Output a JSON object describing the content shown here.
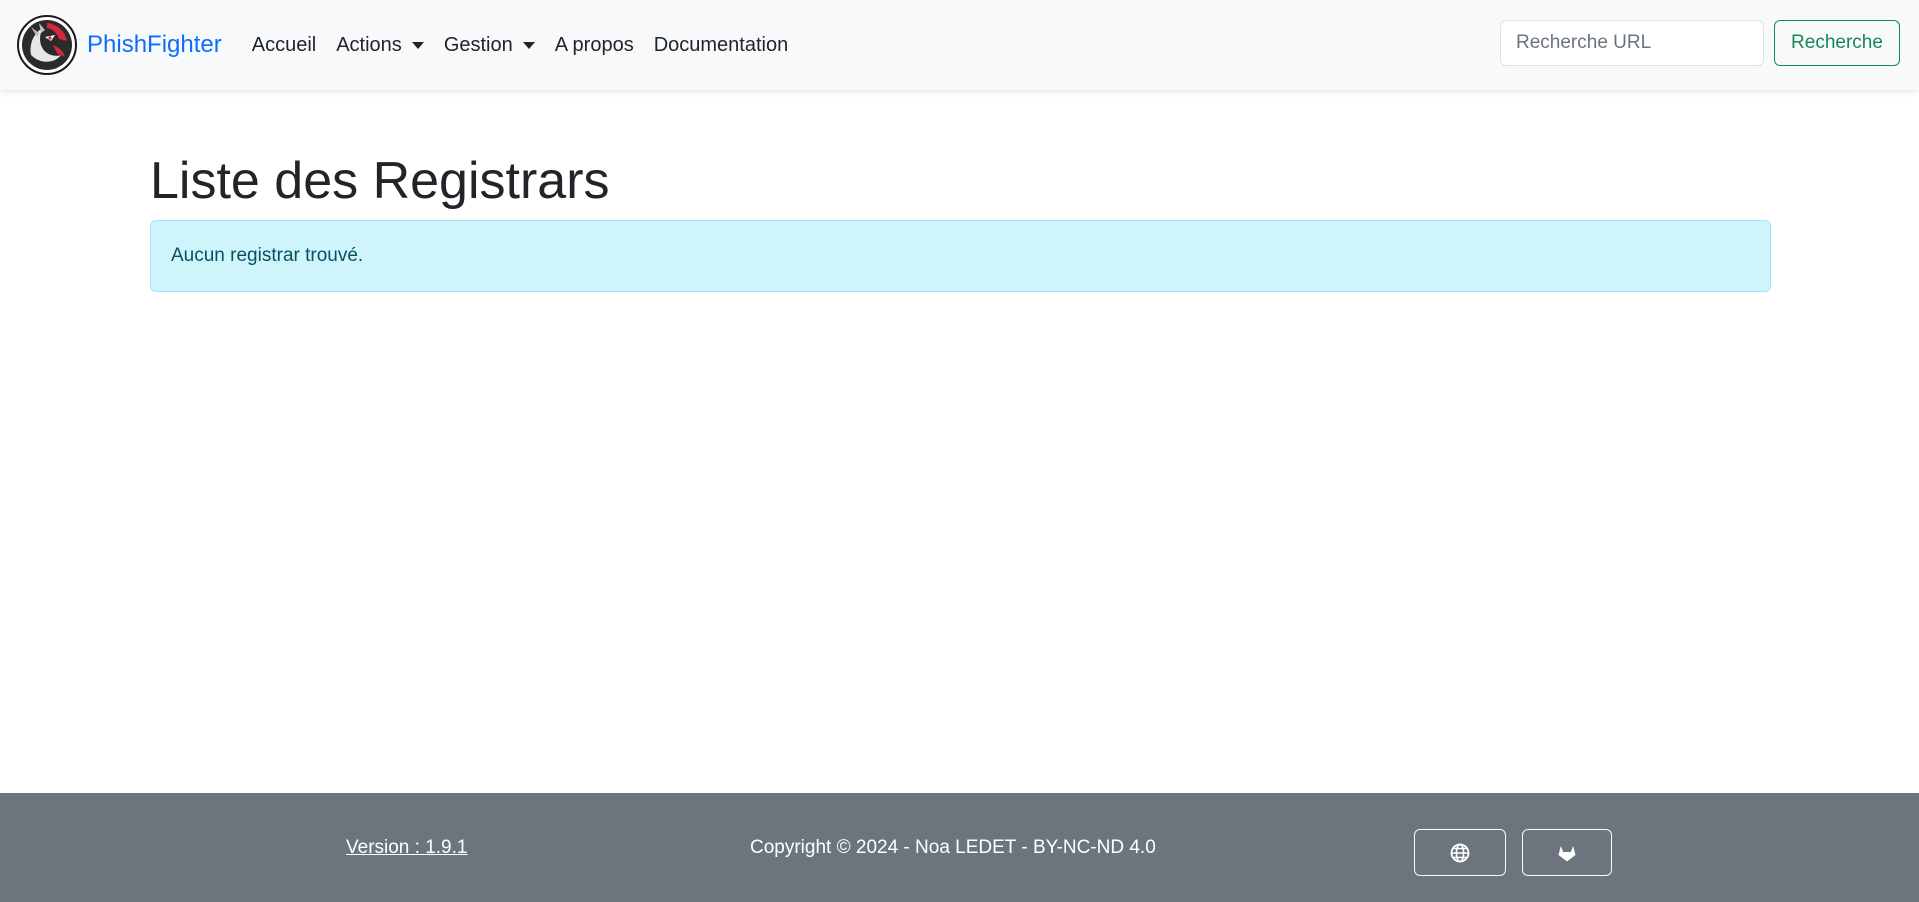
{
  "navbar": {
    "brand": "PhishFighter",
    "links": [
      {
        "label": "Accueil",
        "dropdown": false
      },
      {
        "label": "Actions",
        "dropdown": true
      },
      {
        "label": "Gestion",
        "dropdown": true
      },
      {
        "label": "A propos",
        "dropdown": false
      },
      {
        "label": "Documentation",
        "dropdown": false
      }
    ],
    "search": {
      "placeholder": "Recherche URL",
      "value": "",
      "button_label": "Recherche"
    }
  },
  "main": {
    "title": "Liste des Registrars",
    "alert": "Aucun registrar trouvé."
  },
  "footer": {
    "version": "Version : 1.9.1",
    "copyright": "Copyright © 2024 - Noa LEDET - BY-NC-ND 4.0",
    "buttons": [
      {
        "icon": "globe-icon"
      },
      {
        "icon": "gitlab-icon"
      }
    ]
  },
  "colors": {
    "brand": "#0d6efd",
    "navbar_bg": "#f8f9fa",
    "success": "#198754",
    "alert_bg": "#cff4fc",
    "alert_border": "#9eeaf9",
    "alert_text": "#055160",
    "footer_bg": "#6c757d"
  }
}
